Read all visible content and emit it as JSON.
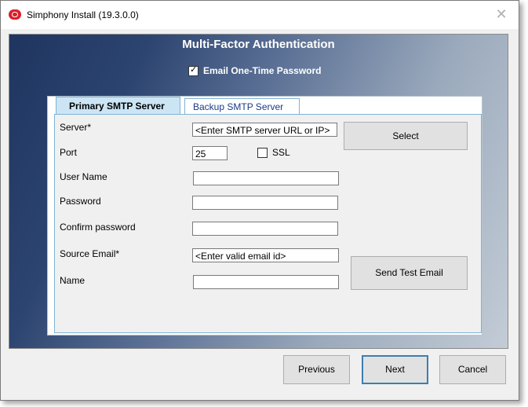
{
  "window": {
    "title": "Simphony Install (19.3.0.0)",
    "close_symbol": "✕"
  },
  "header": {
    "title": "Multi-Factor Authentication"
  },
  "otp_option": {
    "label": "Email One-Time Password",
    "checked": true
  },
  "tabs": [
    {
      "label": "Primary SMTP Server",
      "active": true
    },
    {
      "label": "Backup SMTP Server",
      "active": false
    }
  ],
  "form": {
    "server": {
      "label": "Server*",
      "value": "<Enter SMTP server URL or IP>"
    },
    "port": {
      "label": "Port",
      "value": "25"
    },
    "ssl": {
      "label": "SSL",
      "checked": false
    },
    "username": {
      "label": "User Name",
      "value": ""
    },
    "password": {
      "label": "Password",
      "value": ""
    },
    "confirm_password": {
      "label": "Confirm password",
      "value": ""
    },
    "source_email": {
      "label": "Source Email*",
      "value": "<Enter valid email id>"
    },
    "name": {
      "label": "Name",
      "value": ""
    },
    "select_button": "Select",
    "send_test_button": "Send Test Email"
  },
  "footer": {
    "previous": "Previous",
    "next": "Next",
    "cancel": "Cancel"
  }
}
